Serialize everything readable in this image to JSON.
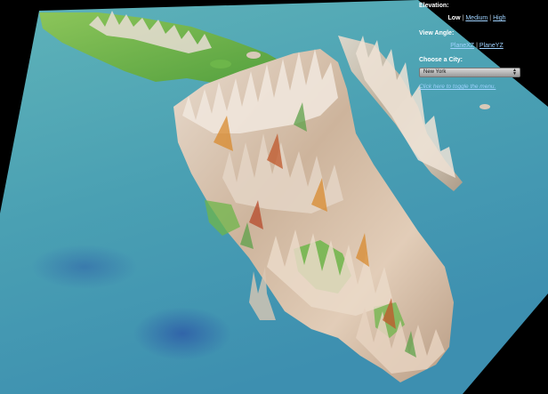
{
  "menu": {
    "elevation_heading": "Elevation:",
    "elevation_options": [
      "Low",
      "Medium",
      "High"
    ],
    "elevation_selected": "Low",
    "view_angle_heading": "View Angle:",
    "view_angle_options": [
      "PlaneXZ",
      "PlaneYZ"
    ],
    "city_heading": "Choose a City:",
    "city_selected": "New York",
    "toggle_text": "Click here to toggle the menu."
  },
  "colors": {
    "background": "#000000",
    "ocean": "#5aa8b8",
    "land_green": "#6db64a",
    "mountain_peak": "#e8ddd4",
    "link": "#9fd2ff"
  }
}
